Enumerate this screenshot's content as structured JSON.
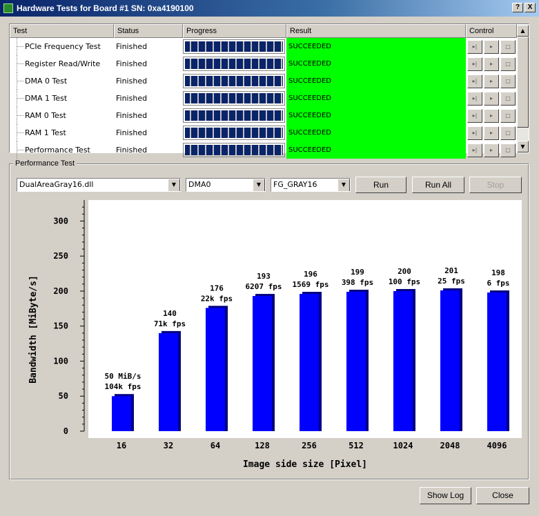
{
  "window": {
    "title": "Hardware Tests for Board #1  SN: 0xa4190100",
    "help_label": "?",
    "close_label": "X"
  },
  "list": {
    "headers": [
      "Test",
      "Status",
      "Progress",
      "Result",
      "Control"
    ],
    "rows": [
      {
        "test": "PCIe Frequency Test",
        "status": "Finished",
        "progress": 1.0,
        "result": "SUCCEEDED"
      },
      {
        "test": "Register Read/Write",
        "status": "Finished",
        "progress": 1.0,
        "result": "SUCCEEDED"
      },
      {
        "test": "DMA 0 Test",
        "status": "Finished",
        "progress": 1.0,
        "result": "SUCCEEDED"
      },
      {
        "test": "DMA 1 Test",
        "status": "Finished",
        "progress": 1.0,
        "result": "SUCCEEDED"
      },
      {
        "test": "RAM 0 Test",
        "status": "Finished",
        "progress": 1.0,
        "result": "SUCCEEDED"
      },
      {
        "test": "RAM 1 Test",
        "status": "Finished",
        "progress": 1.0,
        "result": "SUCCEEDED"
      },
      {
        "test": "Performance Test",
        "status": "Finished",
        "progress": 1.0,
        "result": "SUCCEEDED"
      }
    ],
    "control_glyphs": [
      "▸|",
      "▸",
      "□"
    ],
    "scroll_up": "▲",
    "scroll_down": "▼"
  },
  "perf": {
    "group_title": "Performance Test",
    "applet": "DualAreaGray16.dll",
    "dma": "DMA0",
    "format": "FG_GRAY16",
    "combo_arrow": "▼",
    "run_label": "Run",
    "run_all_label": "Run All",
    "stop_label": "Stop"
  },
  "chart_data": {
    "type": "bar",
    "categories": [
      "16",
      "32",
      "64",
      "128",
      "256",
      "512",
      "1024",
      "2048",
      "4096"
    ],
    "values": [
      50,
      140,
      176,
      193,
      196,
      199,
      200,
      201,
      198
    ],
    "value_labels": [
      "50 MiB/s",
      "140",
      "176",
      "193",
      "196",
      "199",
      "200",
      "201",
      "198"
    ],
    "fps_labels": [
      "104k fps",
      "71k fps",
      "22k fps",
      "6207 fps",
      "1569 fps",
      "398 fps",
      "100 fps",
      "25 fps",
      "6 fps"
    ],
    "ylabel": "Bandwidth [MiByte/s]",
    "xlabel": "Image side size [Pixel]",
    "ylim": [
      0,
      330
    ],
    "yticks": [
      0,
      50,
      100,
      150,
      200,
      250,
      300
    ],
    "bar_color": "#0000ff",
    "bar_shadow_color": "#000080"
  },
  "footer": {
    "show_log_label": "Show Log",
    "close_label": "Close"
  },
  "colors": {
    "success": "#00ff00",
    "titlebar": "#0a246a",
    "face": "#d4d0c8"
  }
}
